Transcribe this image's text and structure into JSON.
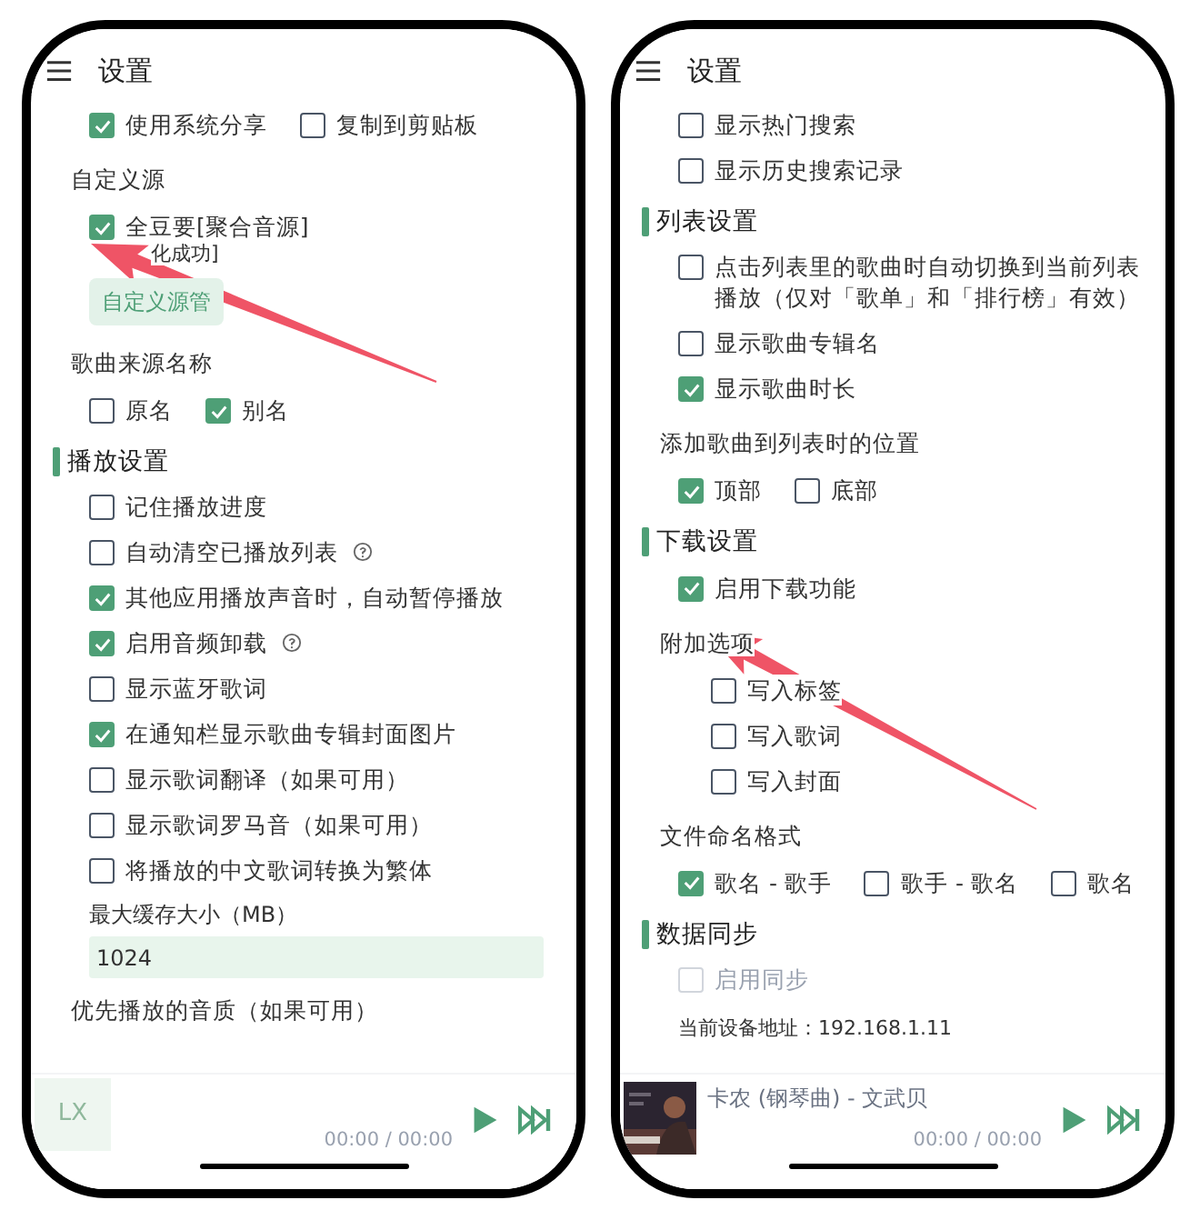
{
  "phones": [
    {
      "title": "设置",
      "annotated": true,
      "items": [
        {
          "kind": "checks",
          "options": [
            {
              "label": "使用系统分享",
              "checked": true
            },
            {
              "label": "复制到剪贴板",
              "checked": false
            }
          ]
        },
        {
          "kind": "label",
          "text": "自定义源"
        },
        {
          "kind": "checks",
          "options": [
            {
              "label": "全豆要[聚合音源]",
              "note": "化成功]",
              "checked": true
            }
          ]
        },
        {
          "kind": "button",
          "text": "自定义源管"
        },
        {
          "kind": "label",
          "text": "歌曲来源名称"
        },
        {
          "kind": "checks",
          "options": [
            {
              "label": "原名",
              "checked": false
            },
            {
              "label": "别名",
              "checked": true
            }
          ]
        },
        {
          "kind": "section",
          "text": "播放设置"
        },
        {
          "kind": "checks",
          "options": [
            {
              "label": "记住播放进度",
              "checked": false
            }
          ]
        },
        {
          "kind": "checks",
          "options": [
            {
              "label": "自动清空已播放列表",
              "checked": false,
              "help": true
            }
          ]
        },
        {
          "kind": "checks",
          "options": [
            {
              "label": "其他应用播放声音时，自动暂停播放",
              "checked": true
            }
          ]
        },
        {
          "kind": "checks",
          "options": [
            {
              "label": "启用音频卸载",
              "checked": true,
              "help": true
            }
          ]
        },
        {
          "kind": "checks",
          "options": [
            {
              "label": "显示蓝牙歌词",
              "checked": false
            }
          ]
        },
        {
          "kind": "checks",
          "options": [
            {
              "label": "在通知栏显示歌曲专辑封面图片",
              "checked": true
            }
          ]
        },
        {
          "kind": "checks",
          "options": [
            {
              "label": "显示歌词翻译（如果可用）",
              "checked": false
            }
          ]
        },
        {
          "kind": "checks",
          "options": [
            {
              "label": "显示歌词罗马音（如果可用）",
              "checked": false
            }
          ]
        },
        {
          "kind": "checks",
          "options": [
            {
              "label": "将播放的中文歌词转换为繁体",
              "checked": false
            }
          ]
        },
        {
          "kind": "input",
          "label": "最大缓存大小（MB）",
          "value": "1024"
        },
        {
          "kind": "label",
          "text": "优先播放的音质（如果可用）"
        }
      ],
      "player": {
        "cover": {
          "kind": "logo",
          "text": "LX"
        },
        "time": "00:00 / 00:00"
      }
    },
    {
      "title": "设置",
      "annotated": true,
      "items": [
        {
          "kind": "checks",
          "options": [
            {
              "label": "显示热门搜索",
              "checked": false
            }
          ]
        },
        {
          "kind": "checks",
          "options": [
            {
              "label": "显示历史搜索记录",
              "checked": false
            }
          ]
        },
        {
          "kind": "section",
          "text": "列表设置"
        },
        {
          "kind": "checks",
          "options": [
            {
              "label": "点击列表里的歌曲时自动切换到当前列表播放（仅对「歌单」和「排行榜」有效）",
              "checked": false
            }
          ]
        },
        {
          "kind": "checks",
          "options": [
            {
              "label": "显示歌曲专辑名",
              "checked": false
            }
          ]
        },
        {
          "kind": "checks",
          "options": [
            {
              "label": "显示歌曲时长",
              "checked": true
            }
          ]
        },
        {
          "kind": "label",
          "text": "添加歌曲到列表时的位置"
        },
        {
          "kind": "checks",
          "options": [
            {
              "label": "顶部",
              "checked": true
            },
            {
              "label": "底部",
              "checked": false
            }
          ]
        },
        {
          "kind": "section",
          "text": "下载设置"
        },
        {
          "kind": "checks",
          "options": [
            {
              "label": "启用下载功能",
              "checked": true
            }
          ]
        },
        {
          "kind": "label",
          "text": "附加选项"
        },
        {
          "kind": "group",
          "children": [
            {
              "kind": "checks",
              "options": [
                {
                  "label": "写入标签",
                  "checked": false
                }
              ]
            },
            {
              "kind": "checks",
              "options": [
                {
                  "label": "写入歌词",
                  "checked": false
                }
              ]
            },
            {
              "kind": "checks",
              "options": [
                {
                  "label": "写入封面",
                  "checked": false
                }
              ]
            }
          ]
        },
        {
          "kind": "label",
          "text": "文件命名格式"
        },
        {
          "kind": "checks",
          "options": [
            {
              "label": "歌名 - 歌手",
              "checked": true
            },
            {
              "label": "歌手 - 歌名",
              "checked": false
            },
            {
              "label": "歌名",
              "checked": false
            }
          ]
        },
        {
          "kind": "section",
          "text": "数据同步"
        },
        {
          "kind": "checks",
          "options": [
            {
              "label": "启用同步",
              "checked": false,
              "disabled": true
            }
          ]
        },
        {
          "kind": "note",
          "text": "当前设备地址：192.168.1.11"
        }
      ],
      "player": {
        "title": "卡农 (钢琴曲) - 文武贝",
        "time": "00:00 / 00:00"
      }
    }
  ]
}
